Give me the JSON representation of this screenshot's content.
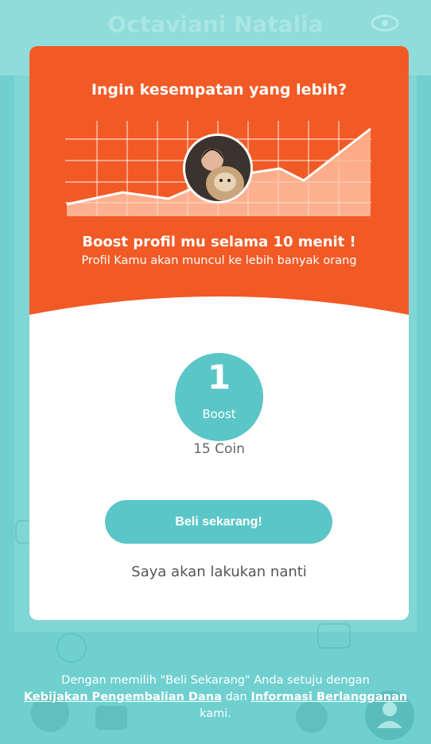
{
  "background": {
    "profile_name": "Octaviani Natalia",
    "eye_icon": "eye-icon",
    "nav_icons": [
      "card-stack-icon",
      "camera-icon",
      "chat-icon",
      "user-icon"
    ]
  },
  "modal": {
    "title": "Ingin kesempatan yang lebih?",
    "headline": "Boost profil mu selama 10 menit !",
    "subline": "Profil Kamu akan muncul ke lebih banyak orang",
    "boost_count": "1",
    "boost_label": "Boost",
    "price": "15 Coin",
    "buy_button": "Beli sekarang!",
    "later_link": "Saya akan lakukan nanti"
  },
  "terms": {
    "prefix": "Dengan memilih \"Beli Sekarang\" Anda setuju dengan",
    "refund_link": "Kebijakan Pengembalian Dana",
    "middle": "dan",
    "subscription_link": "Informasi Berlangganan",
    "suffix": "kami."
  },
  "colors": {
    "accent_orange": "#f25a25",
    "teal": "#5bc6c8",
    "background_teal": "#6fd0cf"
  }
}
